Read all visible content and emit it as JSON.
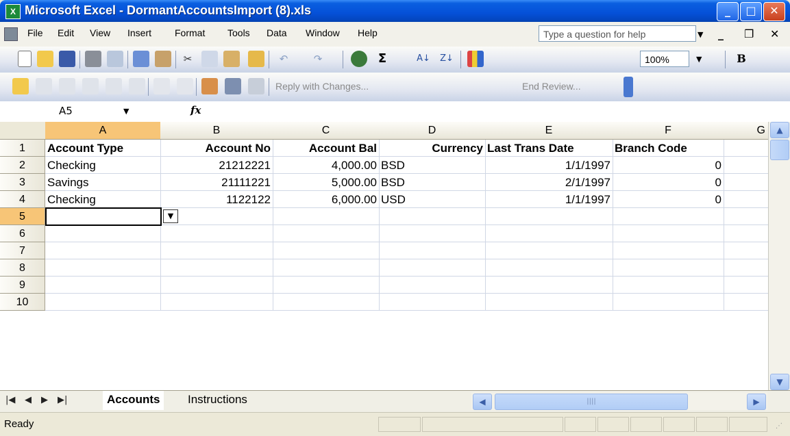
{
  "window": {
    "title": "Microsoft Excel - DormantAccountsImport (8).xls",
    "app_icon": "excel-icon",
    "controls": [
      "minimize-icon",
      "maximize-icon",
      "close-icon"
    ]
  },
  "menubar": {
    "items": [
      "File",
      "Edit",
      "View",
      "Insert",
      "Format",
      "Tools",
      "Data",
      "Window",
      "Help"
    ],
    "help_placeholder": "Type a question for help"
  },
  "toolbar": {
    "zoom": "100%",
    "bold_label": "B",
    "reply_label": "Reply with Changes...",
    "end_review_label": "End Review..."
  },
  "formula_bar": {
    "name_box": "A5",
    "fx_label": "fx",
    "content": ""
  },
  "grid": {
    "columns": [
      "A",
      "B",
      "C",
      "D",
      "E",
      "F",
      "G"
    ],
    "rows": [
      "1",
      "2",
      "3",
      "4",
      "5",
      "6",
      "7",
      "8",
      "9",
      "10"
    ],
    "active_cell": "A5",
    "header_row": [
      "Account Type",
      "Account No",
      "Account Bal",
      "Currency",
      "Last Trans Date",
      "Branch Code"
    ],
    "data_rows": [
      [
        "Checking",
        "21212221",
        "4,000.00",
        "BSD",
        "1/1/1997",
        "0"
      ],
      [
        "Savings",
        "21111221",
        "5,000.00",
        "BSD",
        "2/1/1997",
        "0"
      ],
      [
        "Checking",
        "1122122",
        "6,000.00",
        "USD",
        "1/1/1997",
        "0"
      ]
    ]
  },
  "sheet_tabs": {
    "tabs": [
      "Accounts",
      "Instructions"
    ],
    "active": "Accounts"
  },
  "status": {
    "text": "Ready"
  },
  "colors": {
    "titlebar": "#0550d8",
    "active_header": "#f7c577",
    "gridline": "#d0d7e5"
  }
}
